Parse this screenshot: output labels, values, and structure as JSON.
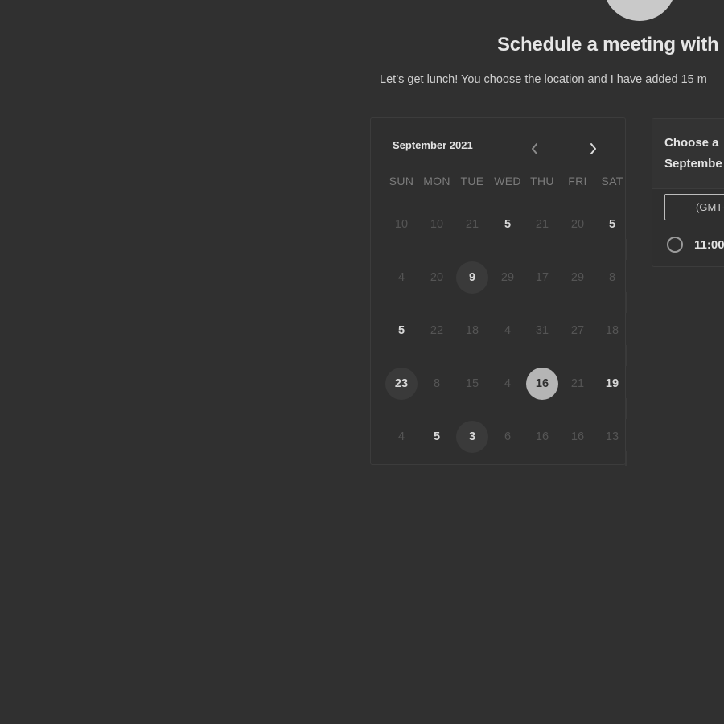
{
  "header": {
    "title": "Schedule a meeting with",
    "subtitle": "Let’s get lunch! You choose the location and I have added 15 m"
  },
  "calendar": {
    "month_label": "September 2021",
    "prev_icon": "chevron-left-icon",
    "next_icon": "chevron-right-icon",
    "weekdays": [
      "SUN",
      "MON",
      "TUE",
      "WED",
      "THU",
      "FRI",
      "SAT"
    ],
    "weeks": [
      [
        {
          "label": "10",
          "state": "disabled"
        },
        {
          "label": "10",
          "state": "disabled"
        },
        {
          "label": "21",
          "state": "disabled"
        },
        {
          "label": "5",
          "state": "available"
        },
        {
          "label": "21",
          "state": "disabled"
        },
        {
          "label": "20",
          "state": "disabled"
        },
        {
          "label": "5",
          "state": "available"
        }
      ],
      [
        {
          "label": "4",
          "state": "disabled"
        },
        {
          "label": "20",
          "state": "disabled"
        },
        {
          "label": "9",
          "state": "highlighted"
        },
        {
          "label": "29",
          "state": "disabled"
        },
        {
          "label": "17",
          "state": "disabled"
        },
        {
          "label": "29",
          "state": "disabled"
        },
        {
          "label": "8",
          "state": "disabled"
        }
      ],
      [
        {
          "label": "5",
          "state": "available"
        },
        {
          "label": "22",
          "state": "disabled"
        },
        {
          "label": "18",
          "state": "disabled"
        },
        {
          "label": "4",
          "state": "disabled"
        },
        {
          "label": "31",
          "state": "disabled"
        },
        {
          "label": "27",
          "state": "disabled"
        },
        {
          "label": "18",
          "state": "disabled"
        }
      ],
      [
        {
          "label": "23",
          "state": "highlighted"
        },
        {
          "label": "8",
          "state": "disabled"
        },
        {
          "label": "15",
          "state": "disabled"
        },
        {
          "label": "4",
          "state": "disabled"
        },
        {
          "label": "16",
          "state": "selected"
        },
        {
          "label": "21",
          "state": "disabled"
        },
        {
          "label": "19",
          "state": "available"
        }
      ],
      [
        {
          "label": "4",
          "state": "disabled"
        },
        {
          "label": "5",
          "state": "available"
        },
        {
          "label": "3",
          "state": "highlighted"
        },
        {
          "label": "6",
          "state": "disabled"
        },
        {
          "label": "16",
          "state": "disabled"
        },
        {
          "label": "16",
          "state": "disabled"
        },
        {
          "label": "13",
          "state": "disabled"
        }
      ]
    ]
  },
  "time_panel": {
    "choose_label": "Choose a",
    "date_label": "Septembe",
    "timezone": "(GMT-",
    "slots": [
      {
        "label": "11:00",
        "selected": false
      }
    ]
  },
  "colors": {
    "background": "#303030",
    "selected_day": "#b5b5b5",
    "highlighted_day": "#3a3a3a",
    "available_text": "#d8d8d8",
    "disabled_text": "#555555"
  }
}
